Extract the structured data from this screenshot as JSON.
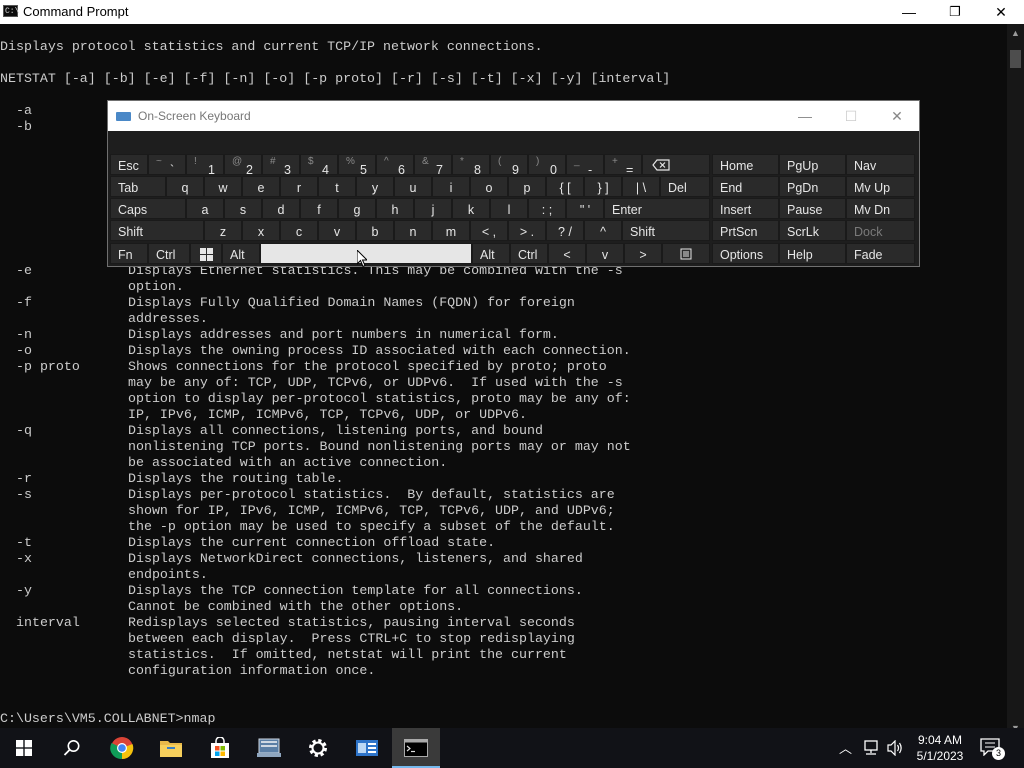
{
  "window": {
    "title": "Command Prompt",
    "minimize": "—",
    "maximize": "❐",
    "close": "✕"
  },
  "console": {
    "intro": "Displays protocol statistics and current TCP/IP network connections.",
    "usage": "NETSTAT [-a] [-b] [-e] [-f] [-n] [-o] [-p proto] [-r] [-s] [-t] [-x] [-y] [interval]",
    "rows": [
      {
        "opt": "-a",
        "desc": ""
      },
      {
        "opt": "-b",
        "desc": ""
      },
      {
        "opt": "-e",
        "desc": "Displays Ethernet statistics. This may be combined with the -s"
      },
      {
        "opt": "",
        "desc": "option."
      },
      {
        "opt": "-f",
        "desc": "Displays Fully Qualified Domain Names (FQDN) for foreign"
      },
      {
        "opt": "",
        "desc": "addresses."
      },
      {
        "opt": "-n",
        "desc": "Displays addresses and port numbers in numerical form."
      },
      {
        "opt": "-o",
        "desc": "Displays the owning process ID associated with each connection."
      },
      {
        "opt": "-p proto",
        "desc": "Shows connections for the protocol specified by proto; proto"
      },
      {
        "opt": "",
        "desc": "may be any of: TCP, UDP, TCPv6, or UDPv6.  If used with the -s"
      },
      {
        "opt": "",
        "desc": "option to display per-protocol statistics, proto may be any of:"
      },
      {
        "opt": "",
        "desc": "IP, IPv6, ICMP, ICMPv6, TCP, TCPv6, UDP, or UDPv6."
      },
      {
        "opt": "-q",
        "desc": "Displays all connections, listening ports, and bound"
      },
      {
        "opt": "",
        "desc": "nonlistening TCP ports. Bound nonlistening ports may or may not"
      },
      {
        "opt": "",
        "desc": "be associated with an active connection."
      },
      {
        "opt": "-r",
        "desc": "Displays the routing table."
      },
      {
        "opt": "-s",
        "desc": "Displays per-protocol statistics.  By default, statistics are"
      },
      {
        "opt": "",
        "desc": "shown for IP, IPv6, ICMP, ICMPv6, TCP, TCPv6, UDP, and UDPv6;"
      },
      {
        "opt": "",
        "desc": "the -p option may be used to specify a subset of the default."
      },
      {
        "opt": "-t",
        "desc": "Displays the current connection offload state."
      },
      {
        "opt": "-x",
        "desc": "Displays NetworkDirect connections, listeners, and shared"
      },
      {
        "opt": "",
        "desc": "endpoints."
      },
      {
        "opt": "-y",
        "desc": "Displays the TCP connection template for all connections."
      },
      {
        "opt": "",
        "desc": "Cannot be combined with the other options."
      },
      {
        "opt": "interval",
        "desc": "Redisplays selected statistics, pausing interval seconds"
      },
      {
        "opt": "",
        "desc": "between each display.  Press CTRL+C to stop redisplaying"
      },
      {
        "opt": "",
        "desc": "statistics.  If omitted, netstat will print the current"
      },
      {
        "opt": "",
        "desc": "configuration information once."
      }
    ],
    "prompt": "C:\\Users\\VM5.COLLABNET>nmap"
  },
  "osk": {
    "title": "On-Screen Keyboard",
    "row1": [
      [
        "Esc",
        ""
      ],
      [
        "~",
        "`"
      ],
      [
        "!",
        "1"
      ],
      [
        "@",
        "2"
      ],
      [
        "#",
        "3"
      ],
      [
        "$",
        "4"
      ],
      [
        "%",
        "5"
      ],
      [
        "^",
        "6"
      ],
      [
        "&",
        "7"
      ],
      [
        "*",
        "8"
      ],
      [
        "(",
        "9"
      ],
      [
        ")",
        "0"
      ],
      [
        "_",
        "-"
      ],
      [
        "+",
        "="
      ]
    ],
    "row2": [
      "Tab",
      "q",
      "w",
      "e",
      "r",
      "t",
      "y",
      "u",
      "i",
      "o",
      "p",
      "{ [",
      "} ]",
      "| \\",
      "Del"
    ],
    "row3": [
      "Caps",
      "a",
      "s",
      "d",
      "f",
      "g",
      "h",
      "j",
      "k",
      "l",
      ": ;",
      "\" '",
      "Enter"
    ],
    "row4": [
      "Shift",
      "z",
      "x",
      "c",
      "v",
      "b",
      "n",
      "m",
      "< ,",
      "> .",
      "? /",
      "^",
      "Shift"
    ],
    "row5": [
      "Fn",
      "Ctrl",
      "Alt",
      "Alt",
      "Ctrl",
      "<",
      "v",
      ">"
    ],
    "nav": [
      [
        "Home",
        "PgUp",
        "Nav"
      ],
      [
        "End",
        "PgDn",
        "Mv Up"
      ],
      [
        "Insert",
        "Pause",
        "Mv Dn"
      ],
      [
        "PrtScn",
        "ScrLk",
        "Dock"
      ],
      [
        "Options",
        "Help",
        "Fade"
      ]
    ]
  },
  "taskbar": {
    "time": "9:04 AM",
    "date": "5/1/2023",
    "notifications": "3"
  }
}
